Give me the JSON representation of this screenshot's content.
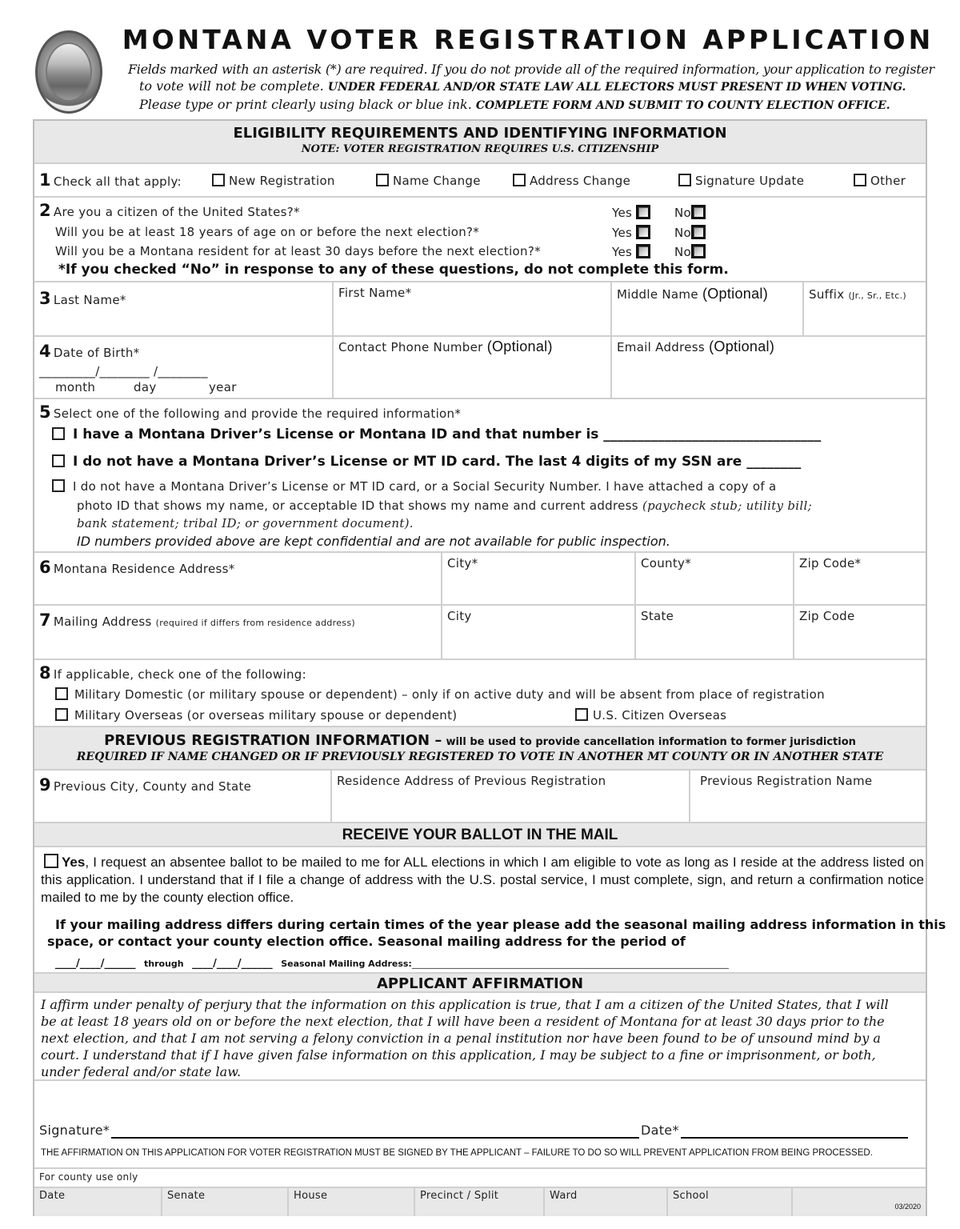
{
  "header": {
    "seal_icon": "montana-state-seal",
    "title": "MONTANA VOTER REGISTRATION APPLICATION",
    "intro_line1": "Fields marked with an asterisk (*) are required. If you do not provide all of the required information, your application to register",
    "intro_line2_plain": "to vote will not be complete. ",
    "intro_line2_bold": "UNDER FEDERAL AND/OR STATE LAW ALL ELECTORS MUST PRESENT ID WHEN VOTING.",
    "intro_line3_plain": "Please type or print clearly using black or blue ink. ",
    "intro_line3_bold": "COMPLETE FORM AND SUBMIT TO COUNTY ELECTION OFFICE."
  },
  "eligibility": {
    "title": "ELIGIBILITY REQUIREMENTS AND IDENTIFYING INFORMATION",
    "note": "NOTE: VOTER REGISTRATION REQUIRES U.S. CITIZENSHIP"
  },
  "q1": {
    "number": "1",
    "label": "Check all that apply:",
    "options": [
      "New Registration",
      "Name Change",
      "Address Change",
      "Signature Update",
      "Other"
    ]
  },
  "q2": {
    "number": "2",
    "questions": [
      "Are you a citizen of the United States?*",
      "Will you be at least 18 years of age on or before the next election?*",
      "Will you be a Montana resident for at least 30 days before the next election?*"
    ],
    "yes_label": "Yes",
    "no_label": "No",
    "warning": "*If you checked “No” in response to any of these questions, do not complete this form."
  },
  "q3": {
    "number": "3",
    "last_name": "Last Name*",
    "first_name": "First Name*",
    "middle_name": "Middle Name",
    "middle_optional": "(Optional)",
    "suffix": "Suffix",
    "suffix_hint": "(Jr., Sr., Etc.)"
  },
  "q4": {
    "number": "4",
    "dob": "Date of Birth*",
    "dob_blanks": "_________/________ /________",
    "month": "month",
    "day": "day",
    "year": "year",
    "phone": "Contact Phone Number",
    "phone_optional": "(Optional)",
    "email": "Email Address",
    "email_optional": "(Optional)"
  },
  "q5": {
    "number": "5",
    "label": "Select one of the following and provide the required information*",
    "opt1": "I have a Montana Driver’s License or Montana ID and that number is ________________________________",
    "opt2": "I do not have a Montana Driver’s License or MT ID card. The last 4 digits of my SSN are ________",
    "opt3_line1": "I do not have a Montana Driver’s License or MT ID card, or a Social Security Number.  I have attached a copy of a",
    "opt3_line2_plain": "photo ID that shows my name, or acceptable ID that shows my name and current address ",
    "opt3_line2_italic": "(paycheck stub; utility bill;",
    "opt3_line3": "bank statement; tribal ID; or government document).",
    "confidential": "ID numbers provided above are kept confidential and are not available for public inspection."
  },
  "q6": {
    "number": "6",
    "address": "Montana Residence Address*",
    "city": "City*",
    "county": "County*",
    "zip": "Zip Code*"
  },
  "q7": {
    "number": "7",
    "address": "Mailing Address",
    "address_hint": "(required if differs from residence address)",
    "city": "City",
    "state": "State",
    "zip": "Zip Code"
  },
  "q8": {
    "number": "8",
    "label": "If applicable, check one of the following:",
    "opt1": "Military Domestic (or military spouse or dependent) – only if on active duty and will be absent from place of registration",
    "opt2": "Military Overseas (or overseas military spouse or dependent)",
    "opt3": "U.S. Citizen Overseas"
  },
  "previous": {
    "title": "PREVIOUS REGISTRATION INFORMATION –",
    "title_small": "will be used to provide cancellation information to former jurisdiction",
    "note": "REQUIRED IF NAME CHANGED OR IF PREVIOUSLY REGISTERED TO VOTE IN ANOTHER MT COUNTY OR IN ANOTHER STATE"
  },
  "q9": {
    "number": "9",
    "prev_location": "Previous City, County and State",
    "prev_address": "Residence Address of Previous Registration",
    "prev_name": "Previous Registration Name"
  },
  "ballot": {
    "title": "RECEIVE YOUR BALLOT IN THE MAIL",
    "yes": "Yes",
    "text": ", I request an absentee ballot to be mailed to me for ALL elections in which I am eligible to vote as long as I reside at the address listed on this application. I understand that if I file a change of address with the U.S. postal service, I must complete, sign, and return a confirmation notice mailed to me by the county election office.",
    "seasonal_line1": "If your mailing address differs during certain times of the year please add the seasonal mailing address information in this",
    "seasonal_line2": "space, or contact your county election office.   Seasonal mailing address for the period of",
    "period_blank": "____/____/______",
    "through": "through",
    "seasonal_address_label": "Seasonal Mailing Address:",
    "seasonal_address_blank": "________________________________________________________________________"
  },
  "affirmation": {
    "title": "APPLICANT AFFIRMATION",
    "text": "I affirm under penalty of perjury that the information on this application is true, that I am a citizen of the United States, that I will be at least 18 years old on or before the next election, that I will have been a resident of Montana for at least 30 days prior to the next election, and that I am not serving a felony conviction in a penal institution nor have been found to be of unsound mind by a court.  I understand that if I have given false information on this application,  I may be subject to a fine or imprisonment, or both, under federal and/or state law.",
    "signature": "Signature*",
    "date": "Date*",
    "warning": "THE AFFIRMATION ON THIS APPLICATION FOR VOTER REGISTRATION MUST BE SIGNED BY THE APPLICANT – FAILURE TO DO SO WILL PREVENT APPLICATION FROM BEING PROCESSED."
  },
  "county_use": {
    "label": "For county use only",
    "columns": [
      "Date",
      "Senate",
      "House",
      "Precinct / Split",
      "Ward",
      "School"
    ],
    "form_version": "03/2020"
  }
}
